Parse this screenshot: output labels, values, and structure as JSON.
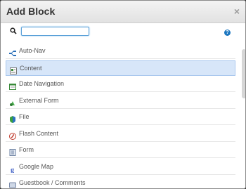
{
  "dialog": {
    "title": "Add Block",
    "close_label": "×"
  },
  "search": {
    "value": "",
    "help_label": "?"
  },
  "blocks": [
    {
      "label": "Auto-Nav",
      "icon": "auto-nav-icon",
      "selected": false
    },
    {
      "label": "Content",
      "icon": "content-icon",
      "selected": true
    },
    {
      "label": "Date Navigation",
      "icon": "date-navigation-icon",
      "selected": false
    },
    {
      "label": "External Form",
      "icon": "external-form-icon",
      "selected": false
    },
    {
      "label": "File",
      "icon": "file-icon",
      "selected": false
    },
    {
      "label": "Flash Content",
      "icon": "flash-content-icon",
      "selected": false
    },
    {
      "label": "Form",
      "icon": "form-icon",
      "selected": false
    },
    {
      "label": "Google Map",
      "icon": "google-map-icon",
      "selected": false
    },
    {
      "label": "Guestbook / Comments",
      "icon": "guestbook-icon",
      "selected": false
    }
  ],
  "colors": {
    "accent": "#1c77c0",
    "selected_bg": "#d7e6f9"
  }
}
